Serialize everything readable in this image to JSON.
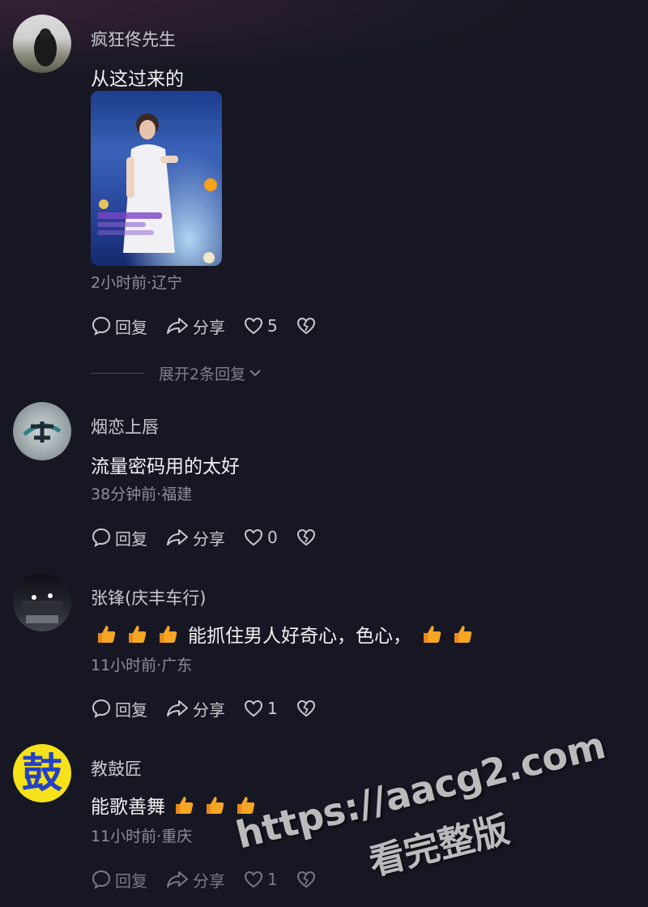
{
  "comments": [
    {
      "username": "疯狂佟先生",
      "text": "从这过来的",
      "meta": "2小时前·辽宁",
      "reply_label": "回复",
      "share_label": "分享",
      "like_count": "5",
      "expand_label": "展开2条回复"
    },
    {
      "username": "烟恋上唇",
      "text": "流量密码用的太好",
      "meta": "38分钟前·福建",
      "reply_label": "回复",
      "share_label": "分享",
      "like_count": "0"
    },
    {
      "username": "张锋(庆丰车行)",
      "text": "能抓住男人好奇心，色心，",
      "meta": "11小时前·广东",
      "reply_label": "回复",
      "share_label": "分享",
      "like_count": "1"
    },
    {
      "username": "教鼓匠",
      "avatar_char": "鼓",
      "text": "能歌善舞",
      "meta": "11小时前·重庆",
      "reply_label": "回复",
      "share_label": "分享",
      "like_count": "1"
    }
  ],
  "watermark": {
    "url": "https://aacg2.com",
    "text": "看完整版"
  },
  "icons": [
    "reply-icon",
    "share-icon",
    "heart-icon",
    "dislike-icon",
    "thumbs-up-emoji",
    "chevron-down-icon"
  ],
  "colors": {
    "background": "#161722",
    "avatar_yellow": "#f5e21a",
    "avatar_text_blue": "#2441c4",
    "emoji_orange": "#f5a623"
  }
}
